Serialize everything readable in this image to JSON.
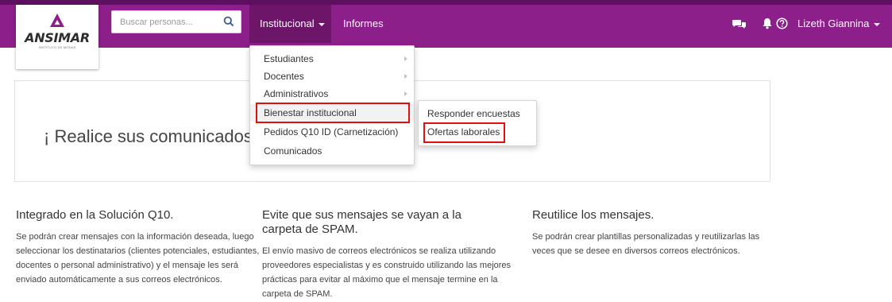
{
  "brand": {
    "logo_text": "ANSIMAR",
    "logo_subtitle": "INSTITUTO DE MODAS"
  },
  "header": {
    "search_placeholder": "Buscar personas...",
    "nav": {
      "institucional": "Institucional",
      "informes": "Informes"
    },
    "user_name": "Lizeth Giannina",
    "colors": {
      "bar": "#8d1f8a",
      "bar_top": "#5e1060",
      "active": "#6d1669"
    },
    "icons": [
      "chat-icon",
      "bell-icon",
      "help-circle-icon"
    ]
  },
  "menu": {
    "items": [
      {
        "label": "Estudiantes",
        "has_submenu": true
      },
      {
        "label": "Docentes",
        "has_submenu": true
      },
      {
        "label": "Administrativos",
        "has_submenu": true
      },
      {
        "label": "Bienestar institucional",
        "has_submenu": false
      },
      {
        "label": "Pedidos Q10 ID (Carnetización)",
        "has_submenu": false
      },
      {
        "label": "Comunicados",
        "has_submenu": false
      }
    ],
    "submenu": [
      {
        "label": "Responder encuestas"
      },
      {
        "label": "Ofertas laborales"
      }
    ],
    "highlight_color": "#e01010"
  },
  "hero": {
    "text": "¡ Realice sus comunicados d"
  },
  "features": [
    {
      "title": "Integrado en la Solución Q10.",
      "body": "Se podrán crear mensajes con la información deseada, luego seleccionar los destinatarios (clientes potenciales, estudiantes, docentes o personal administrativo) y el mensaje les será enviado automáticamente a sus correos electrónicos."
    },
    {
      "title": "Evite que sus mensajes se vayan a la carpeta de SPAM.",
      "body": "El envío masivo de correos electrónicos se realiza utilizando proveedores especialistas y es construido utilizando las mejores prácticas para evitar al máximo que el mensaje termine en la carpeta de SPAM."
    },
    {
      "title": "Reutilice los mensajes.",
      "body": "Se podrán crear plantillas personalizadas y reutilizarlas las veces que se desee en diversos correos electrónicos."
    }
  ]
}
